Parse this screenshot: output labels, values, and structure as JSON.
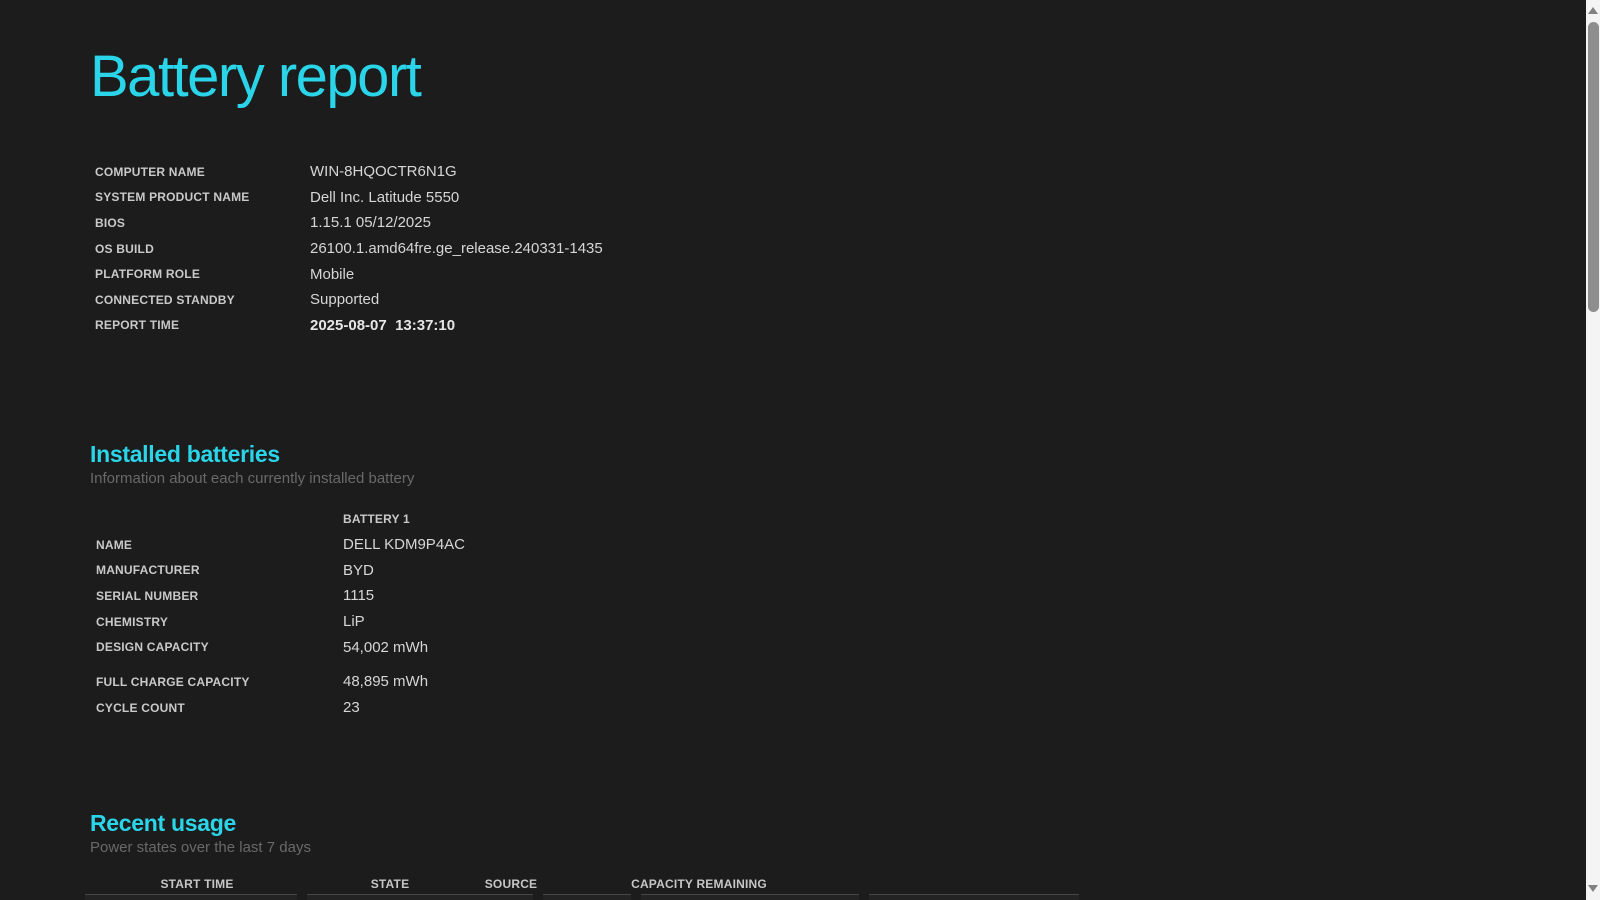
{
  "page": {
    "title": "Battery report",
    "colors": {
      "background": "#1c1c1c",
      "accent": "#2bd5e9",
      "label": "#c9c9c9",
      "value": "#d6d6d6",
      "subtitle": "#696969",
      "scrollbar_track": "#f4f4f4",
      "scrollbar_thumb": "#8e8e8e"
    }
  },
  "system_info": {
    "rows": [
      {
        "label": "COMPUTER NAME",
        "value": "WIN-8HQOCTR6N1G"
      },
      {
        "label": "SYSTEM PRODUCT NAME",
        "value": "Dell Inc. Latitude 5550"
      },
      {
        "label": "BIOS",
        "value": "1.15.1 05/12/2025"
      },
      {
        "label": "OS BUILD",
        "value": "26100.1.amd64fre.ge_release.240331-1435"
      },
      {
        "label": "PLATFORM ROLE",
        "value": "Mobile"
      },
      {
        "label": "CONNECTED STANDBY",
        "value": "Supported"
      },
      {
        "label": "REPORT TIME",
        "value": "2025-08-07  13:37:10"
      }
    ]
  },
  "installed_batteries": {
    "heading": "Installed batteries",
    "subtitle": "Information about each currently installed battery",
    "column_header": "BATTERY 1",
    "rows": [
      {
        "label": "NAME",
        "value": "DELL KDM9P4AC"
      },
      {
        "label": "MANUFACTURER",
        "value": "BYD"
      },
      {
        "label": "SERIAL NUMBER",
        "value": "1115"
      },
      {
        "label": "CHEMISTRY",
        "value": "LiP"
      },
      {
        "label": "DESIGN CAPACITY",
        "value": "54,002 mWh"
      }
    ],
    "rows_secondary": [
      {
        "label": "FULL CHARGE CAPACITY",
        "value": "48,895 mWh"
      },
      {
        "label": "CYCLE COUNT",
        "value": "23"
      }
    ]
  },
  "recent_usage": {
    "heading": "Recent usage",
    "subtitle": "Power states over the last 7 days",
    "columns": [
      "START TIME",
      "STATE",
      "SOURCE",
      "CAPACITY REMAINING"
    ]
  }
}
